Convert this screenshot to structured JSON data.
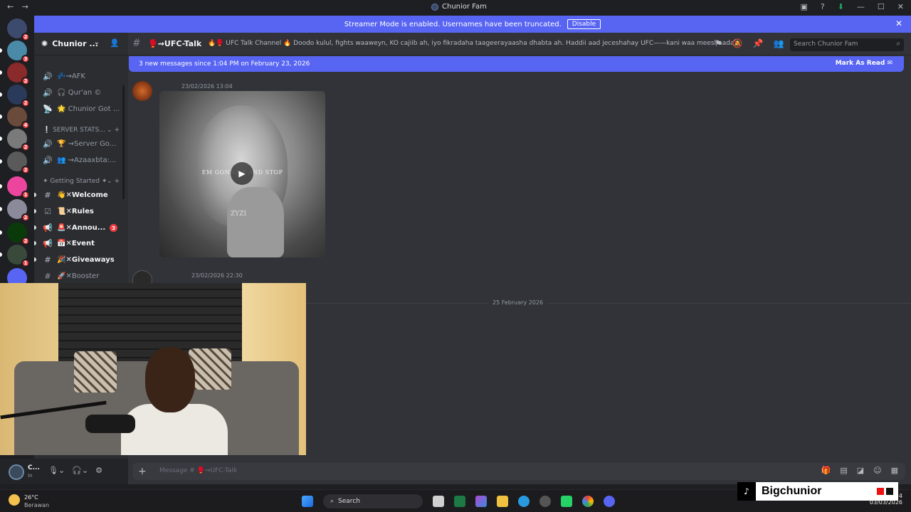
{
  "titlebar": {
    "title": "Chunior Fam",
    "back": "←",
    "forward": "→"
  },
  "banner": {
    "text": "Streamer Mode is enabled. Usernames have been truncated.",
    "disable_label": "Disable",
    "close": "✕"
  },
  "servers": [
    {
      "color": "#3c4a6e",
      "badge": "2"
    },
    {
      "color": "#4a8aa8",
      "badge": "3"
    },
    {
      "color": "#8a2a2a",
      "badge": "2"
    },
    {
      "color": "#2a3a5a",
      "badge": "2"
    },
    {
      "color": "#6a4a3a",
      "badge": "4"
    },
    {
      "color": "#7a7a7a",
      "badge": "2"
    },
    {
      "color": "#5a5a5a",
      "badge": "2"
    },
    {
      "color": "#eb459e",
      "badge": "1"
    },
    {
      "color": "#8a8a9a",
      "badge": "2"
    },
    {
      "color": "#0a3a0a",
      "badge": "2"
    },
    {
      "color": "#3a4a3a",
      "badge": "1"
    },
    {
      "color": "#5865f2",
      "badge": ""
    }
  ],
  "sidebar": {
    "guild_name": "Chunior ...",
    "channels": [
      {
        "icon": "🔊",
        "label": "💤⇝AFK",
        "bright": false
      },
      {
        "icon": "🔊",
        "label": "🎧 Qur'an ©",
        "bright": false
      },
      {
        "icon": "📡",
        "label": "🌟 Chunior Got ...",
        "bright": false
      },
      {
        "icon": "🔊",
        "label": "🏆 ⇝Server Go...",
        "bright": false
      },
      {
        "icon": "🔊",
        "label": "👥 ⇝Azaaxbta:...",
        "bright": false
      },
      {
        "icon": "#",
        "label": "👋✕Welcome",
        "bright": true
      },
      {
        "icon": "☑",
        "label": "📜✕Rules",
        "bright": true
      },
      {
        "icon": "📢",
        "label": "🚨✕Annou...",
        "bright": true,
        "count": "3"
      },
      {
        "icon": "📢",
        "label": "📅✕Event",
        "bright": true
      },
      {
        "icon": "#",
        "label": "🎉✕Giveaways",
        "bright": true
      },
      {
        "icon": "#",
        "label": "🚀✕Booster",
        "bright": false
      }
    ],
    "categories": [
      {
        "label": "❕ SERVER STATS...",
        "plus": "⌄ +"
      },
      {
        "label": "✦ Getting Started ✦",
        "plus": "⌄ +"
      }
    ]
  },
  "header": {
    "channel_name": "🥊⇝UFC-Talk",
    "topic": "🔥🥊 UFC Talk Channel 🔥 Doodo kulul, fights waaweyn, KO cajiib ah, iyo fikradaha taageerayaasha dhabta ah. Haddii aad jeceshahay UFC——kani waa meeshaada!",
    "search_placeholder": "Search Chunior Fam"
  },
  "new_messages": {
    "text": "3 new messages since 1:04 PM on February 23, 2026",
    "mark_label": "Mark As Read"
  },
  "messages": [
    {
      "time": "23/02/2026 13:04",
      "avatar_color": "#8a2a1a"
    },
    {
      "time": "23/02/2026 22:30",
      "avatar_color": "#2a2a2a"
    }
  ],
  "video": {
    "caption": "EM GONNA T    AND STOP",
    "watermark": "ZYZI",
    "play": "▶"
  },
  "date_divider": "25 February 2026",
  "composer": {
    "placeholder": "Message # 🥊⇝UFC-Talk"
  },
  "user": {
    "name": "C...",
    "status": "In"
  },
  "taskbar": {
    "temp": "26°C",
    "condition": "Berawan",
    "search_label": "Search",
    "time_partial": "24",
    "date": "03/03/2026"
  },
  "overlay": {
    "name": "Bigchunior"
  },
  "colors": {
    "accent": "#5865f2",
    "danger": "#f23f43"
  }
}
